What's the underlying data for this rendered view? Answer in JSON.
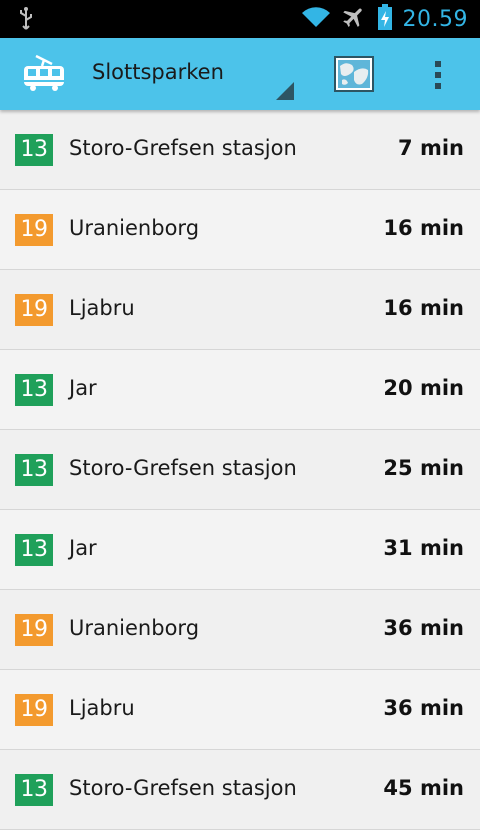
{
  "status_bar": {
    "time": "20.59",
    "icons": [
      "usb-icon",
      "wifi-icon",
      "airplane-mode-icon",
      "battery-charging-icon"
    ]
  },
  "action_bar": {
    "app_icon": "tram-icon",
    "stop_name": "Slottsparken",
    "map_icon": "map-icon",
    "overflow_icon": "overflow-menu-icon"
  },
  "line_colors": {
    "13": "#1fa05a",
    "19": "#f39a2e"
  },
  "departures": [
    {
      "line": "13",
      "destination": "Storo-Grefsen stasjon",
      "eta": "7 min"
    },
    {
      "line": "19",
      "destination": "Uranienborg",
      "eta": "16 min"
    },
    {
      "line": "19",
      "destination": "Ljabru",
      "eta": "16 min"
    },
    {
      "line": "13",
      "destination": "Jar",
      "eta": "20 min"
    },
    {
      "line": "13",
      "destination": "Storo-Grefsen stasjon",
      "eta": "25 min"
    },
    {
      "line": "13",
      "destination": "Jar",
      "eta": "31 min"
    },
    {
      "line": "19",
      "destination": "Uranienborg",
      "eta": "36 min"
    },
    {
      "line": "19",
      "destination": "Ljabru",
      "eta": "36 min"
    },
    {
      "line": "13",
      "destination": "Storo-Grefsen stasjon",
      "eta": "45 min"
    }
  ]
}
